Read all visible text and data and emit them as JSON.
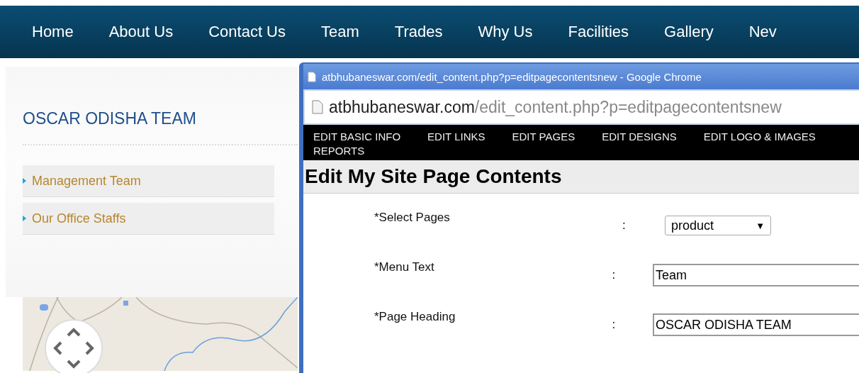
{
  "nav": {
    "items": [
      {
        "label": "Home"
      },
      {
        "label": "About Us"
      },
      {
        "label": "Contact Us"
      },
      {
        "label": "Team"
      },
      {
        "label": "Trades"
      },
      {
        "label": "Why Us"
      },
      {
        "label": "Facilities"
      },
      {
        "label": "Gallery"
      },
      {
        "label": "Nev"
      }
    ]
  },
  "sidebar": {
    "title": "OSCAR ODISHA TEAM",
    "items": [
      {
        "label": "Management Team"
      },
      {
        "label": "Our Office Staffs"
      }
    ]
  },
  "popup": {
    "title": "atbhubaneswar.com/edit_content.php?p=editpagecontentsnew - Google Chrome",
    "address": {
      "host": "atbhubaneswar.com",
      "path": "/edit_content.php?p=editpagecontentsnew"
    },
    "menu": [
      {
        "label": "EDIT BASIC INFO"
      },
      {
        "label": "EDIT LINKS"
      },
      {
        "label": "EDIT PAGES"
      },
      {
        "label": "EDIT DESIGNS"
      },
      {
        "label": "EDIT LOGO & IMAGES"
      },
      {
        "label": "REPORTS"
      }
    ],
    "heading": "Edit My Site Page Contents",
    "form": [
      {
        "kind": "select",
        "label": "*Select Pages",
        "separator": ":",
        "value": "product",
        "arrow": "▼"
      },
      {
        "kind": "text",
        "label": "*Menu Text",
        "separator": ":",
        "value": "Team"
      },
      {
        "kind": "text",
        "label": "*Page Heading",
        "separator": ":",
        "value": "OSCAR ODISHA TEAM"
      }
    ]
  }
}
